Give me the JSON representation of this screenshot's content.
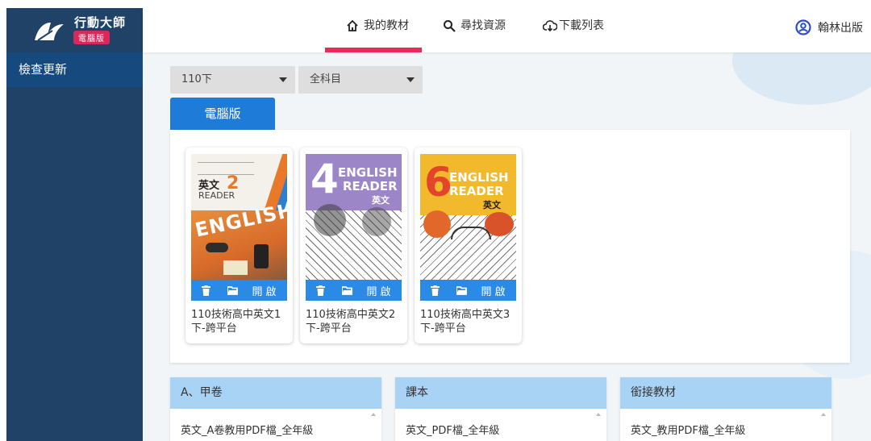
{
  "app": {
    "title": "行動大師",
    "badge": "電腦版"
  },
  "sidebar": {
    "items": [
      {
        "label": "檢查更新"
      }
    ]
  },
  "topbar": {
    "tabs": [
      {
        "label": "我的教材",
        "icon": "home-icon",
        "active": true
      },
      {
        "label": "尋找資源",
        "icon": "search-icon",
        "active": false
      },
      {
        "label": "下載列表",
        "icon": "cloud-download-icon",
        "active": false
      }
    ],
    "user": {
      "label": "翰林出版",
      "icon": "user-circle-icon"
    }
  },
  "filters": {
    "semester": "110下",
    "subject": "全科目"
  },
  "platform_tab": "電腦版",
  "books": [
    {
      "title": "110技術高中英文1下-跨平台",
      "cover": {
        "subject": "英文",
        "level": "2",
        "brand": "READER",
        "word": "ENGLISH"
      },
      "actions": {
        "delete": "trash-icon",
        "folder": "folder-icon",
        "open": "開啟"
      }
    },
    {
      "title": "110技術高中英文2下-跨平台",
      "cover": {
        "number": "4",
        "line1": "ENGLISH",
        "line2": "READER",
        "subject": "英文"
      },
      "actions": {
        "delete": "trash-icon",
        "folder": "folder-icon",
        "open": "開啟"
      }
    },
    {
      "title": "110技術高中英文3下-跨平台",
      "cover": {
        "number": "6",
        "line1": "ENGLISH",
        "line2": "READER",
        "subject": "英文"
      },
      "actions": {
        "delete": "trash-icon",
        "folder": "folder-icon",
        "open": "開啟"
      }
    }
  ],
  "resources": [
    {
      "header": "A、甲卷",
      "item": "英文_A卷教用PDF檔_全年級"
    },
    {
      "header": "課本",
      "item": "英文_PDF檔_全年級"
    },
    {
      "header": "銜接教材",
      "item": "英文_教用PDF檔_全年級"
    }
  ],
  "colors": {
    "sidebar": "#1f4266",
    "accent": "#1f7bd8",
    "active_tab": "#e62c59",
    "card_action": "#2a8ae6",
    "resource_header": "#a9d3f5"
  }
}
